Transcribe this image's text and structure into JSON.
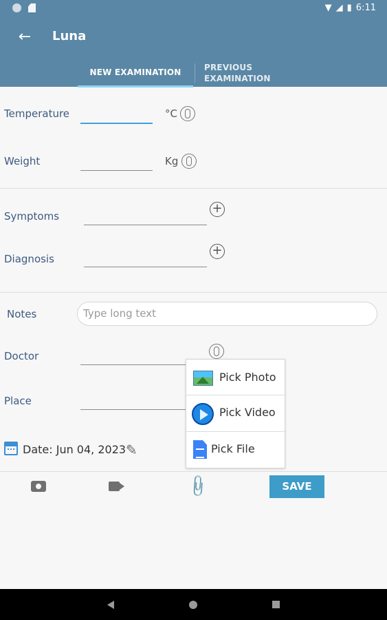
{
  "status_bar": {
    "time": "6:11"
  },
  "app_bar": {
    "title": "Luna"
  },
  "tabs": [
    {
      "label": "NEW EXAMINATION",
      "active": true
    },
    {
      "label": "PREVIOUS EXAMINATION",
      "active": false
    }
  ],
  "form": {
    "temperature": {
      "label": "Temperature",
      "value": "",
      "unit": "°C"
    },
    "weight": {
      "label": "Weight",
      "value": "",
      "unit": "Kg"
    },
    "symptoms": {
      "label": "Symptoms",
      "value": ""
    },
    "diagnosis": {
      "label": "Diagnosis",
      "value": ""
    },
    "notes": {
      "label": "Notes",
      "placeholder": "Type long text",
      "value": ""
    },
    "doctor": {
      "label": "Doctor",
      "value": ""
    },
    "place": {
      "label": "Place",
      "value": ""
    },
    "date": {
      "text": "Date: Jun 04, 2023"
    }
  },
  "attach_menu": {
    "items": [
      {
        "label": "Pick Photo",
        "icon": "photo-icon"
      },
      {
        "label": "Pick Video",
        "icon": "play-video-icon"
      },
      {
        "label": "Pick File",
        "icon": "file-icon"
      }
    ]
  },
  "toolbar": {
    "save_label": "SAVE"
  },
  "colors": {
    "primary": "#5a87a5",
    "tab_indicator": "#8fd2f6",
    "save_button": "#3d9cc8",
    "label": "#3d5a80"
  }
}
